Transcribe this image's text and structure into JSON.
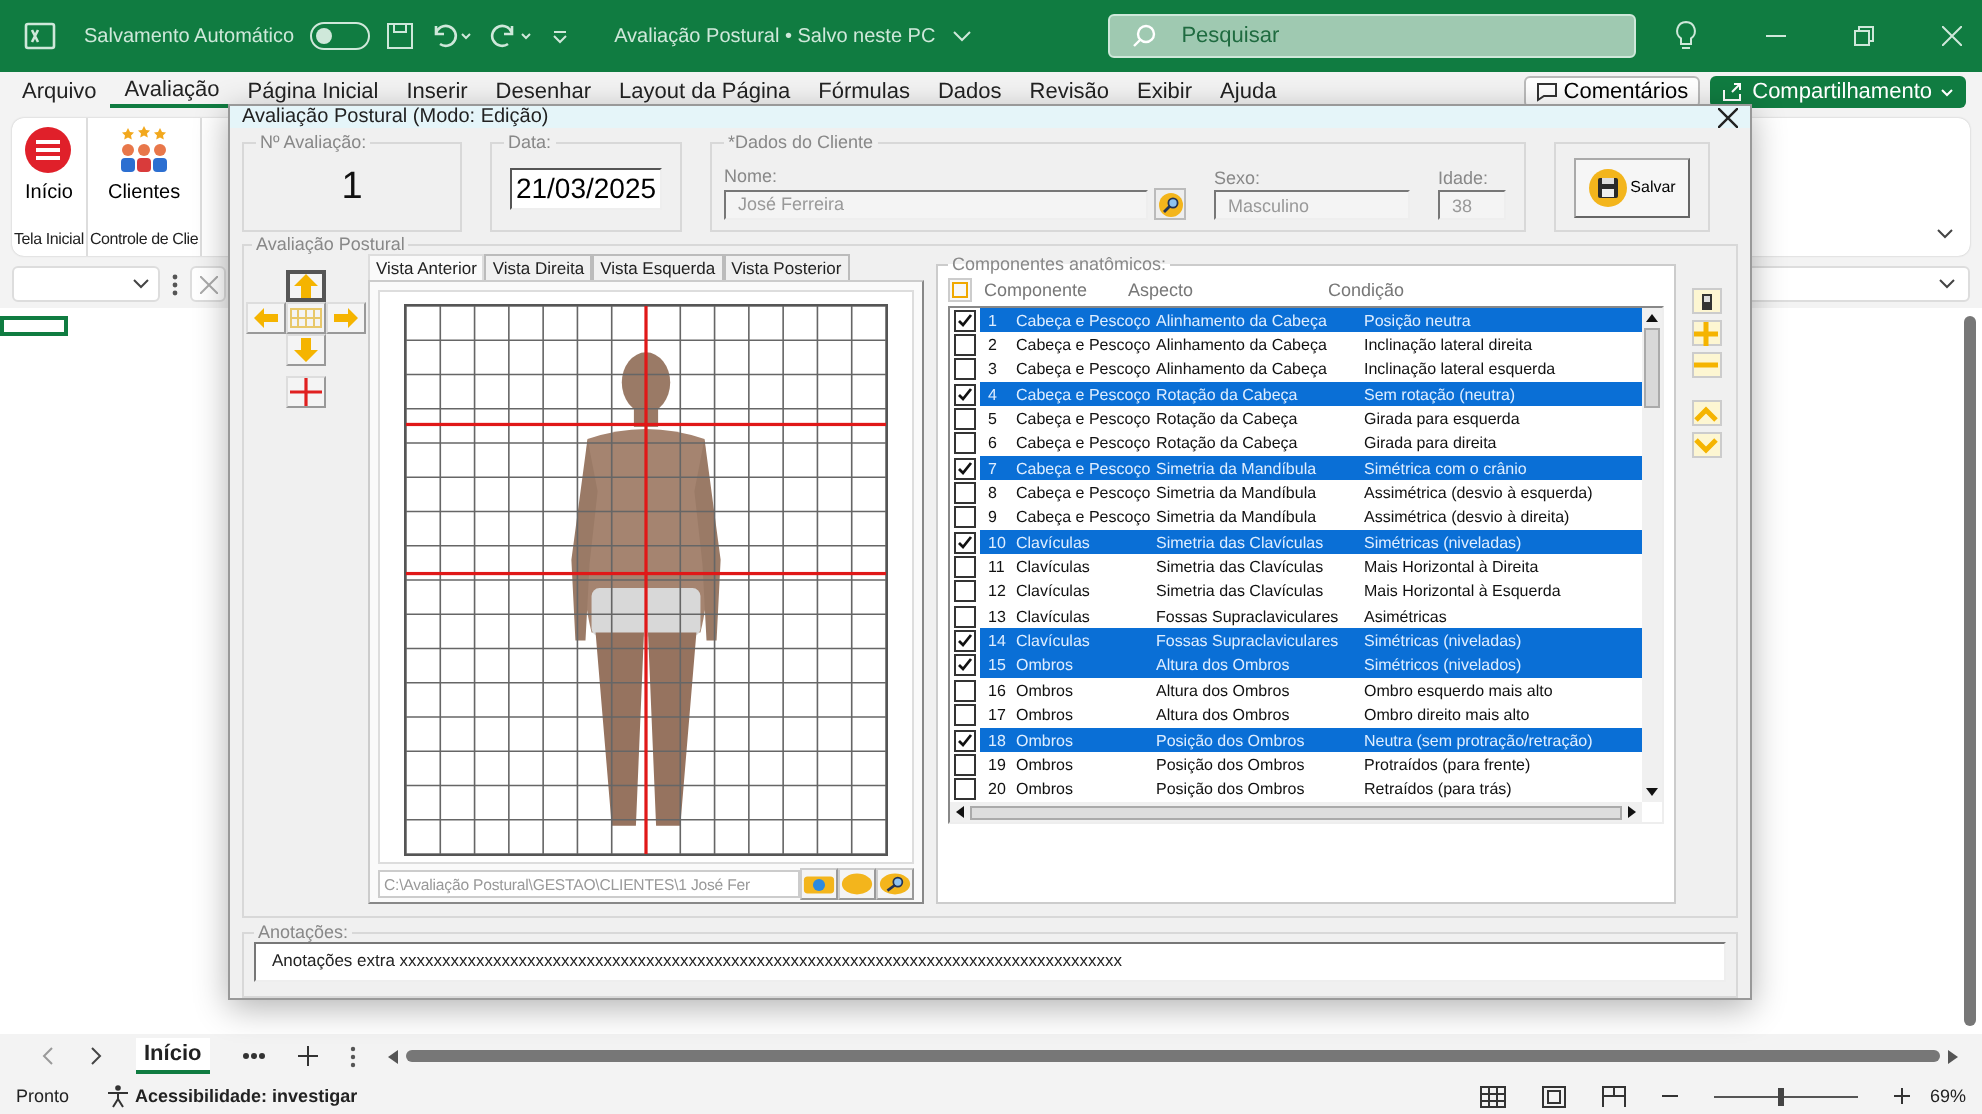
{
  "titlebar": {
    "autosave_label": "Salvamento Automático",
    "autosave_on": false,
    "document_title": "Avaliação Postural • Salvo neste PC",
    "search_placeholder": "Pesquisar"
  },
  "ribbon_tabs": [
    {
      "label": "Arquivo",
      "selected": false
    },
    {
      "label": "Avaliação",
      "selected": true
    },
    {
      "label": "Página Inicial",
      "selected": false
    },
    {
      "label": "Inserir",
      "selected": false
    },
    {
      "label": "Desenhar",
      "selected": false
    },
    {
      "label": "Layout da Página",
      "selected": false
    },
    {
      "label": "Fórmulas",
      "selected": false
    },
    {
      "label": "Dados",
      "selected": false
    },
    {
      "label": "Revisão",
      "selected": false
    },
    {
      "label": "Exibir",
      "selected": false
    },
    {
      "label": "Ajuda",
      "selected": false
    }
  ],
  "ribbon_actions": {
    "comments": "Comentários",
    "share": "Compartilhamento"
  },
  "ribbon_groups": [
    {
      "kind": "menu",
      "button": "Início",
      "group": "Tela Inicial"
    },
    {
      "kind": "people",
      "button": "Clientes",
      "group": "Controle de Clie"
    }
  ],
  "dialog": {
    "title": "Avaliação Postural (Modo: Edição)",
    "evaluation": {
      "label": "Nº Avaliação:",
      "value": "1"
    },
    "date": {
      "label": "Data:",
      "value": "21/03/2025"
    },
    "client": {
      "group": "*Dados do Cliente",
      "name_label": "Nome:",
      "name": "José Ferreira",
      "sex_label": "Sexo:",
      "sex": "Masculino",
      "age_label": "Idade:",
      "age": "38"
    },
    "save_button": "Salvar",
    "posture_group": "Avaliação Postural",
    "view_tabs": [
      {
        "label": "Vista Anterior",
        "selected": true
      },
      {
        "label": "Vista Direita",
        "selected": false
      },
      {
        "label": "Vista Esquerda",
        "selected": false
      },
      {
        "label": "Vista Posterior",
        "selected": false
      }
    ],
    "photo_path": "C:\\Avaliação Postural\\GESTAO\\CLIENTES\\1 José Fer",
    "components": {
      "group": "Componentes anatômicos:",
      "columns": [
        "Componente",
        "Aspecto",
        "Condição"
      ],
      "rows": [
        {
          "checked": true,
          "number": "1",
          "component": "Cabeça e Pescoço",
          "aspect": "Alinhamento da Cabeça",
          "condition": "Posição neutra"
        },
        {
          "checked": false,
          "number": "2",
          "component": "Cabeça e Pescoço",
          "aspect": "Alinhamento da Cabeça",
          "condition": "Inclinação lateral direita"
        },
        {
          "checked": false,
          "number": "3",
          "component": "Cabeça e Pescoço",
          "aspect": "Alinhamento da Cabeça",
          "condition": "Inclinação lateral esquerda"
        },
        {
          "checked": true,
          "number": "4",
          "component": "Cabeça e Pescoço",
          "aspect": "Rotação da Cabeça",
          "condition": "Sem rotação (neutra)"
        },
        {
          "checked": false,
          "number": "5",
          "component": "Cabeça e Pescoço",
          "aspect": "Rotação da Cabeça",
          "condition": "Girada para esquerda"
        },
        {
          "checked": false,
          "number": "6",
          "component": "Cabeça e Pescoço",
          "aspect": "Rotação da Cabeça",
          "condition": "Girada para direita"
        },
        {
          "checked": true,
          "number": "7",
          "component": "Cabeça e Pescoço",
          "aspect": "Simetria da Mandíbula",
          "condition": "Simétrica com o crânio"
        },
        {
          "checked": false,
          "number": "8",
          "component": "Cabeça e Pescoço",
          "aspect": "Simetria da Mandíbula",
          "condition": "Assimétrica (desvio à esquerda)"
        },
        {
          "checked": false,
          "number": "9",
          "component": "Cabeça e Pescoço",
          "aspect": "Simetria da Mandíbula",
          "condition": "Assimétrica (desvio à direita)"
        },
        {
          "checked": true,
          "number": "10",
          "component": "Clavículas",
          "aspect": "Simetria das Clavículas",
          "condition": "Simétricas (niveladas)"
        },
        {
          "checked": false,
          "number": "11",
          "component": "Clavículas",
          "aspect": "Simetria das Clavículas",
          "condition": "Mais Horizontal à Direita"
        },
        {
          "checked": false,
          "number": "12",
          "component": "Clavículas",
          "aspect": "Simetria das Clavículas",
          "condition": "Mais Horizontal à Esquerda"
        },
        {
          "checked": false,
          "number": "13",
          "component": "Clavículas",
          "aspect": "Fossas Supraclaviculares",
          "condition": "Asimétricas"
        },
        {
          "checked": true,
          "number": "14",
          "component": "Clavículas",
          "aspect": "Fossas Supraclaviculares",
          "condition": "Simétricas (niveladas)"
        },
        {
          "checked": true,
          "number": "15",
          "component": "Ombros",
          "aspect": "Altura dos Ombros",
          "condition": "Simétricos (nivelados)"
        },
        {
          "checked": false,
          "number": "16",
          "component": "Ombros",
          "aspect": "Altura dos Ombros",
          "condition": "Ombro esquerdo mais alto"
        },
        {
          "checked": false,
          "number": "17",
          "component": "Ombros",
          "aspect": "Altura dos Ombros",
          "condition": "Ombro direito mais alto"
        },
        {
          "checked": true,
          "number": "18",
          "component": "Ombros",
          "aspect": "Posição dos Ombros",
          "condition": "Neutra (sem protração/retração)"
        },
        {
          "checked": false,
          "number": "19",
          "component": "Ombros",
          "aspect": "Posição dos Ombros",
          "condition": "Protraídos (para frente)"
        },
        {
          "checked": false,
          "number": "20",
          "component": "Ombros",
          "aspect": "Posição dos Ombros",
          "condition": "Retraídos (para trás)"
        }
      ]
    },
    "notes": {
      "label": "Anotações:",
      "value": "Anotações extra xxxxxxxxxxxxxxxxxxxxxxxxxxxxxxxxxxxxxxxxxxxxxxxxxxxxxxxxxxxxxxxxxxxxxxxxxxxxxxxxxxxxx"
    }
  },
  "sheet_tabs": [
    {
      "label": "Início",
      "selected": true
    }
  ],
  "status_bar": {
    "ready": "Pronto",
    "accessibility": "Acessibilidade: investigar",
    "zoom": "69%",
    "zoom_slider": {
      "level": 0.45
    }
  }
}
